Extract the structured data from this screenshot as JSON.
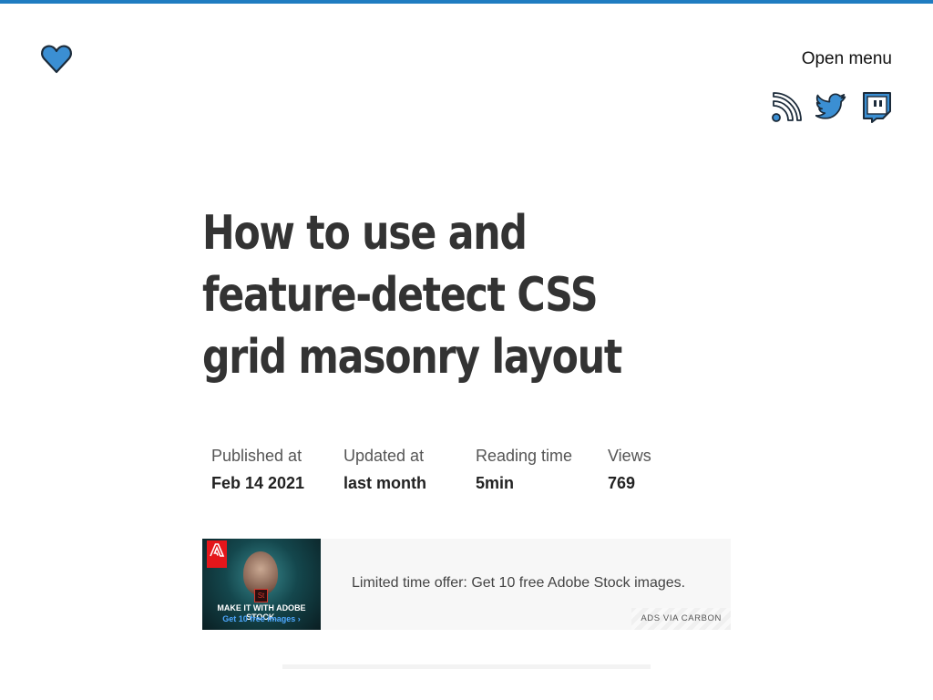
{
  "accent_color": "#1f7cc1",
  "header": {
    "logo_icon": "heart-icon",
    "menu_label": "Open menu",
    "social": [
      {
        "icon": "rss-icon"
      },
      {
        "icon": "twitter-icon"
      },
      {
        "icon": "twitch-icon"
      }
    ]
  },
  "article": {
    "title": "How to use and feature-detect CSS grid masonry layout",
    "meta": [
      {
        "label": "Published at",
        "value": "Feb 14 2021"
      },
      {
        "label": "Updated at",
        "value": "last month"
      },
      {
        "label": "Reading time",
        "value": "5min"
      },
      {
        "label": "Views",
        "value": "769"
      }
    ]
  },
  "ad": {
    "image_brand": "Adobe",
    "image_badge": "St",
    "image_line1": "MAKE IT WITH ADOBE STOCK.",
    "image_line2": "Get 10 free images ›",
    "text": "Limited time offer: Get 10 free Adobe Stock images.",
    "via": "ADS VIA CARBON"
  }
}
